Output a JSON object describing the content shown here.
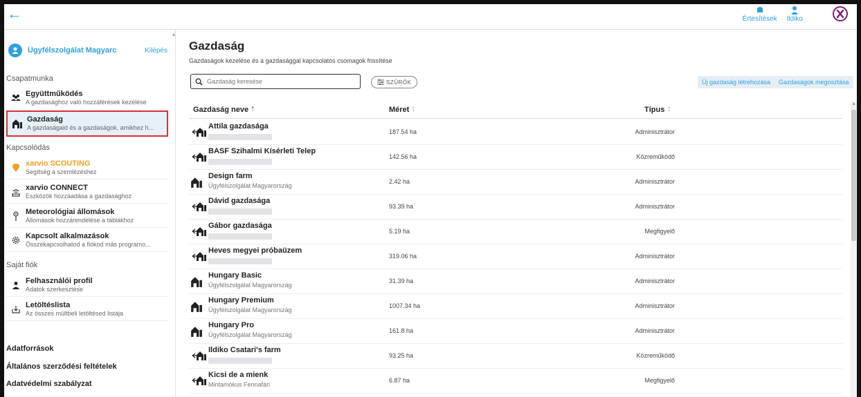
{
  "topbar": {
    "notifications_label": "Értesítések",
    "user_label": "Ildiko"
  },
  "sidebar": {
    "user_name": "Ügyfélszolgálat Magyarc",
    "logout": "Kilépés",
    "sections": [
      "Csapatmunka",
      "Kapcsolódás",
      "Saját fiók"
    ],
    "items": [
      {
        "title": "Együttműködés",
        "desc": "A gazdasághoz való hozzáférések kezelése",
        "icon": "team-icon"
      },
      {
        "title": "Gazdaság",
        "desc": "A gazdaságaid és a gazdaságok, amikhez h...",
        "icon": "farm-icon"
      },
      {
        "title": "xarvio SCOUTING",
        "desc": "Segítség a szemlézéshez",
        "icon": "scouting-pin-icon"
      },
      {
        "title": "xarvio CONNECT",
        "desc": "Eszközök hozzáadása a gazdasághoz",
        "icon": "connect-icon"
      },
      {
        "title": "Meteorológiai állomások",
        "desc": "Állomások hozzárendelése a táblákhoz",
        "icon": "weather-station-icon"
      },
      {
        "title": "Kapcsolt alkalmazások",
        "desc": "Összekapcsolhatod a fiókod más programo...",
        "icon": "gear-icon"
      },
      {
        "title": "Felhasználói profil",
        "desc": "Adatok szerkesztése",
        "icon": "user-icon"
      },
      {
        "title": "Letöltéslista",
        "desc": "Az összes múltbeli letöltésed listája",
        "icon": "download-icon"
      }
    ],
    "footer": [
      "Adatforrások",
      "Általános szerződési feltételek",
      "Adatvédelmi szabályzat"
    ]
  },
  "main": {
    "title": "Gazdaság",
    "subtitle": "Gazdaságok kezelése és a gazdasággal kapcsolatos csomagok frissítése",
    "search_placeholder": "Gazdaság keresése",
    "filter_label": "SZŰRŐK",
    "new_button": "Új gazdaság létrehozása",
    "share_button": "Gazdaságok megosztása",
    "columns": [
      "Gazdaság neve",
      "Méret",
      "Típus"
    ],
    "rows": [
      {
        "name": "Attila gazdasága",
        "owner": "",
        "size": "187.54 ha",
        "role": "Adminisztrátor",
        "shared": true
      },
      {
        "name": "BASF Szihalmi Kísérleti Telep",
        "owner": "",
        "size": "142.56 ha",
        "role": "Közreműködő",
        "shared": true
      },
      {
        "name": "Design farm",
        "owner": "Ügyfélszolgálat Magyarország",
        "size": "2.42 ha",
        "role": "Adminisztrátor",
        "shared": false
      },
      {
        "name": "Dávid gazdasága",
        "owner": "",
        "size": "93.39 ha",
        "role": "Adminisztrátor",
        "shared": true
      },
      {
        "name": "Gábor gazdasága",
        "owner": "",
        "size": "5.19 ha",
        "role": "Megfigyelő",
        "shared": true
      },
      {
        "name": "Heves megyei próbaüzem",
        "owner": "",
        "size": "319.06 ha",
        "role": "Adminisztrátor",
        "shared": true
      },
      {
        "name": "Hungary Basic",
        "owner": "Ügyfélszolgálat Magyarország",
        "size": "31.39 ha",
        "role": "Adminisztrátor",
        "shared": false
      },
      {
        "name": "Hungary Premium",
        "owner": "Ügyfélszolgálat Magyarország",
        "size": "1007.34 ha",
        "role": "Adminisztrátor",
        "shared": false
      },
      {
        "name": "Hungary Pro",
        "owner": "Ügyfélszolgálat Magyarország",
        "size": "161.8 ha",
        "role": "Adminisztrátor",
        "shared": false
      },
      {
        "name": "Ildiko Csatari's farm",
        "owner": "",
        "size": "93.25 ha",
        "role": "Közreműködő",
        "shared": true
      },
      {
        "name": "Kicsi de a mienk",
        "owner": "Mintamókus Fennafán",
        "size": "6.87 ha",
        "role": "Megfigyelő",
        "shared": true
      }
    ]
  },
  "colors": {
    "accent": "#2f9fe0",
    "scouting": "#f0a020",
    "highlight": "#d4303a"
  }
}
